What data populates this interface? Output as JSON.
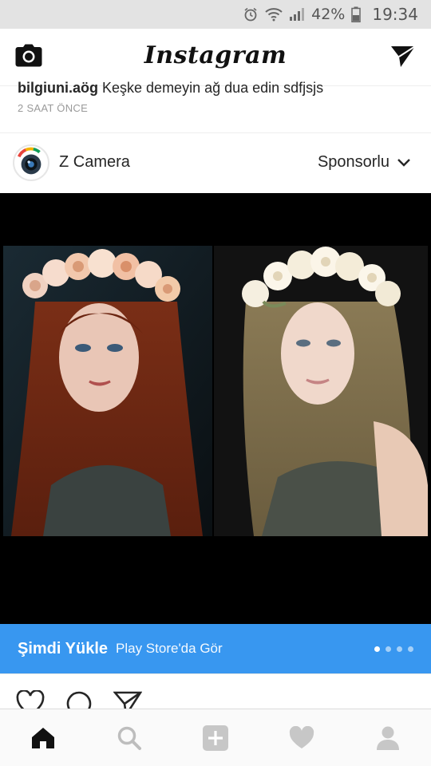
{
  "status_bar": {
    "battery_percent": "42%",
    "time": "19:34",
    "icons": [
      "alarm-icon",
      "wifi-icon",
      "signal-icon",
      "battery-icon"
    ]
  },
  "top_nav": {
    "title": "Instagram",
    "left_icon": "camera-icon",
    "right_icon": "direct-message-icon"
  },
  "previous_post": {
    "username": "bilgiuni.aög",
    "caption_text": "Keşke demeyin ağ dua edin sdfjsjs",
    "time_ago": "2 SAAT ÖNCE"
  },
  "post": {
    "author": "Z Camera",
    "sponsored_label": "Sponsorlu",
    "media": {
      "type": "side-by-side photos",
      "left": "woman with red hair and flower crown",
      "right": "woman with blonde hair and flower crown"
    },
    "cta": {
      "main": "Şimdi Yükle",
      "sub": "Play Store'da Gör"
    },
    "carousel": {
      "count": 4,
      "active_index": 0
    },
    "actions": [
      "like-icon",
      "comment-icon",
      "share-icon"
    ]
  },
  "bottom_nav": {
    "tabs": [
      "home-icon",
      "search-icon",
      "add-icon",
      "activity-icon",
      "profile-icon"
    ],
    "active": "home-icon"
  },
  "colors": {
    "accent": "#3897f0",
    "status_bar": "#e3e3e3",
    "text": "#262626",
    "muted": "#9a9a9a"
  }
}
